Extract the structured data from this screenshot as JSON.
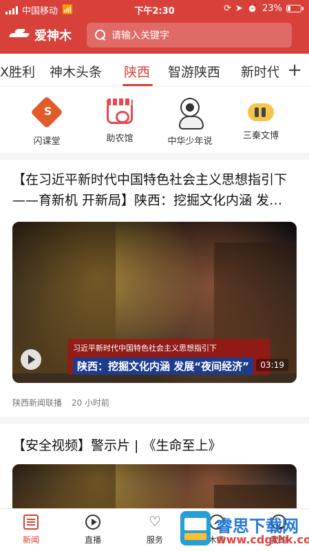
{
  "status_bar": {
    "carrier": "中国移动",
    "time": "下午2:30",
    "battery": "23%",
    "battery_level": 0.23
  },
  "app": {
    "logo_text": "爱神木",
    "search_placeholder": "请输入关键字"
  },
  "tabs": [
    {
      "label": "X胜利"
    },
    {
      "label": "神木头条"
    },
    {
      "label": "陕西",
      "active": true
    },
    {
      "label": "智游陕西"
    },
    {
      "label": "新时代"
    }
  ],
  "quick_menu": [
    {
      "label": "闪课堂",
      "icon": "flash-class-icon"
    },
    {
      "label": "助农馆",
      "icon": "farm-store-icon"
    },
    {
      "label": "中华少年说",
      "icon": "youth-speak-icon"
    },
    {
      "label": "三秦文博",
      "icon": "museum-icon"
    }
  ],
  "articles": [
    {
      "title": "【在习近平新时代中国特色社会主义思想指引下——育新机 开新局】陕西：挖掘文化内涵 发…",
      "video_caption_line1": "习近平新时代中国特色社会主义思想指引下",
      "video_caption_line2": "陕西：挖掘文化内涵 发展“夜间经济”",
      "duration": "03:19",
      "source": "陕西新闻联播",
      "time": "20 小时前"
    },
    {
      "title": "【安全视频】警示片 | 《生命至上》"
    }
  ],
  "bottom_nav": [
    {
      "label": "新闻",
      "active": true,
      "icon": "news-icon"
    },
    {
      "label": "直播",
      "icon": "live-icon"
    },
    {
      "label": "服务",
      "icon": "service-icon"
    },
    {
      "label": "木商",
      "icon": "shop-icon"
    },
    {
      "label": "我的",
      "icon": "me-icon"
    }
  ],
  "watermark": {
    "title": "睿思下载网",
    "url": "www.cdgthk.com"
  },
  "colors": {
    "brand_red": "#d8403a"
  }
}
